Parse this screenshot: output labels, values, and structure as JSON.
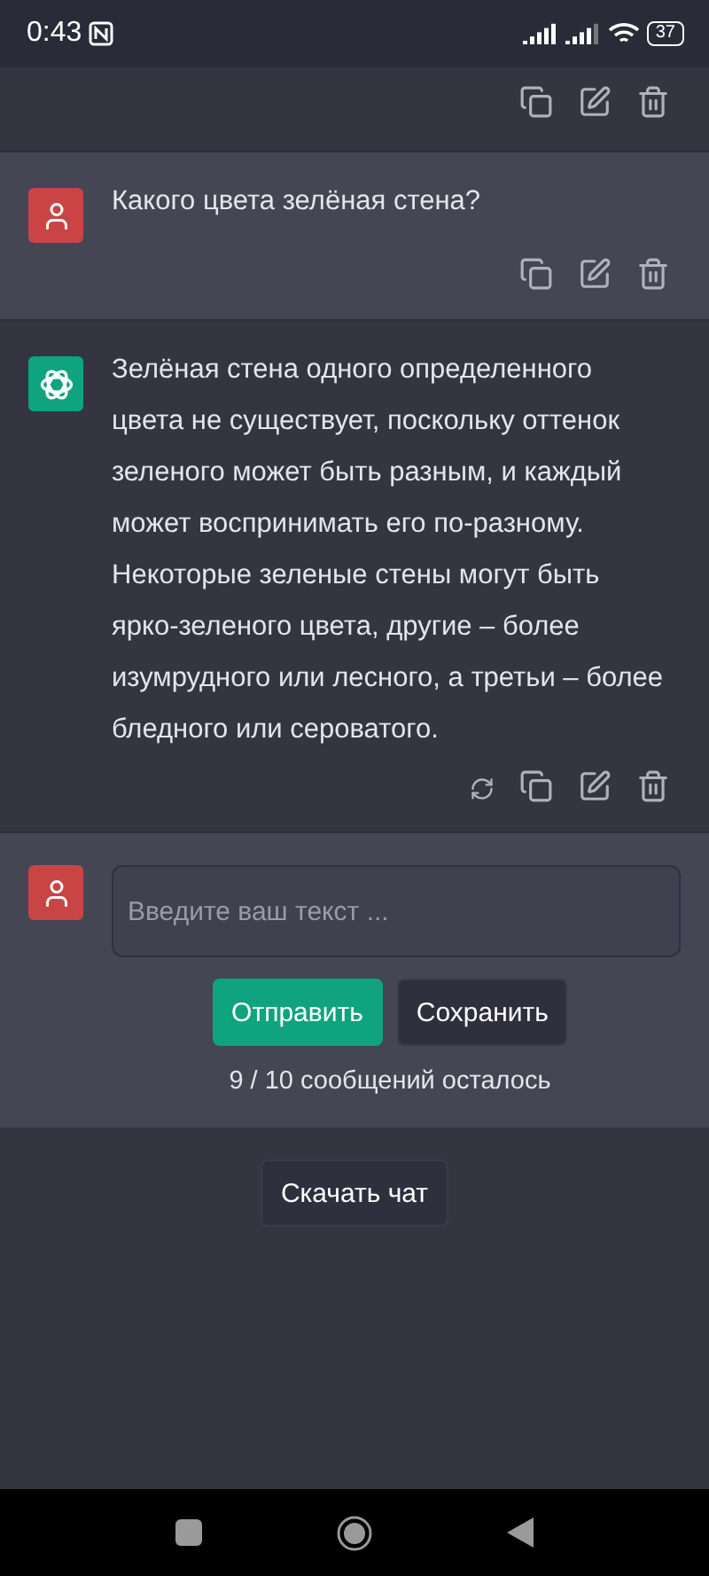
{
  "status_bar": {
    "time": "0:43",
    "battery": "37"
  },
  "messages": [
    {
      "kind": "cut",
      "regenerate": false
    },
    {
      "kind": "user",
      "text": "Какого цвета зелёная стена?",
      "regenerate": false
    },
    {
      "kind": "assistant",
      "text": "Зелёная стена одного определенного цвета не существует, поскольку оттенок зеленого может быть разным, и каждый может воспринимать его по-разному. Некоторые зеленые стены могут быть ярко-зеленого цвета, другие – более изумрудного или лесного, а третьи – более бледного или сероватого.",
      "regenerate": true
    }
  ],
  "composer": {
    "placeholder": "Введите ваш текст ...",
    "send_button": "Отправить",
    "save_button": "Сохранить",
    "remaining": "9 / 10 сообщений осталось"
  },
  "download_button": "Скачать чат"
}
